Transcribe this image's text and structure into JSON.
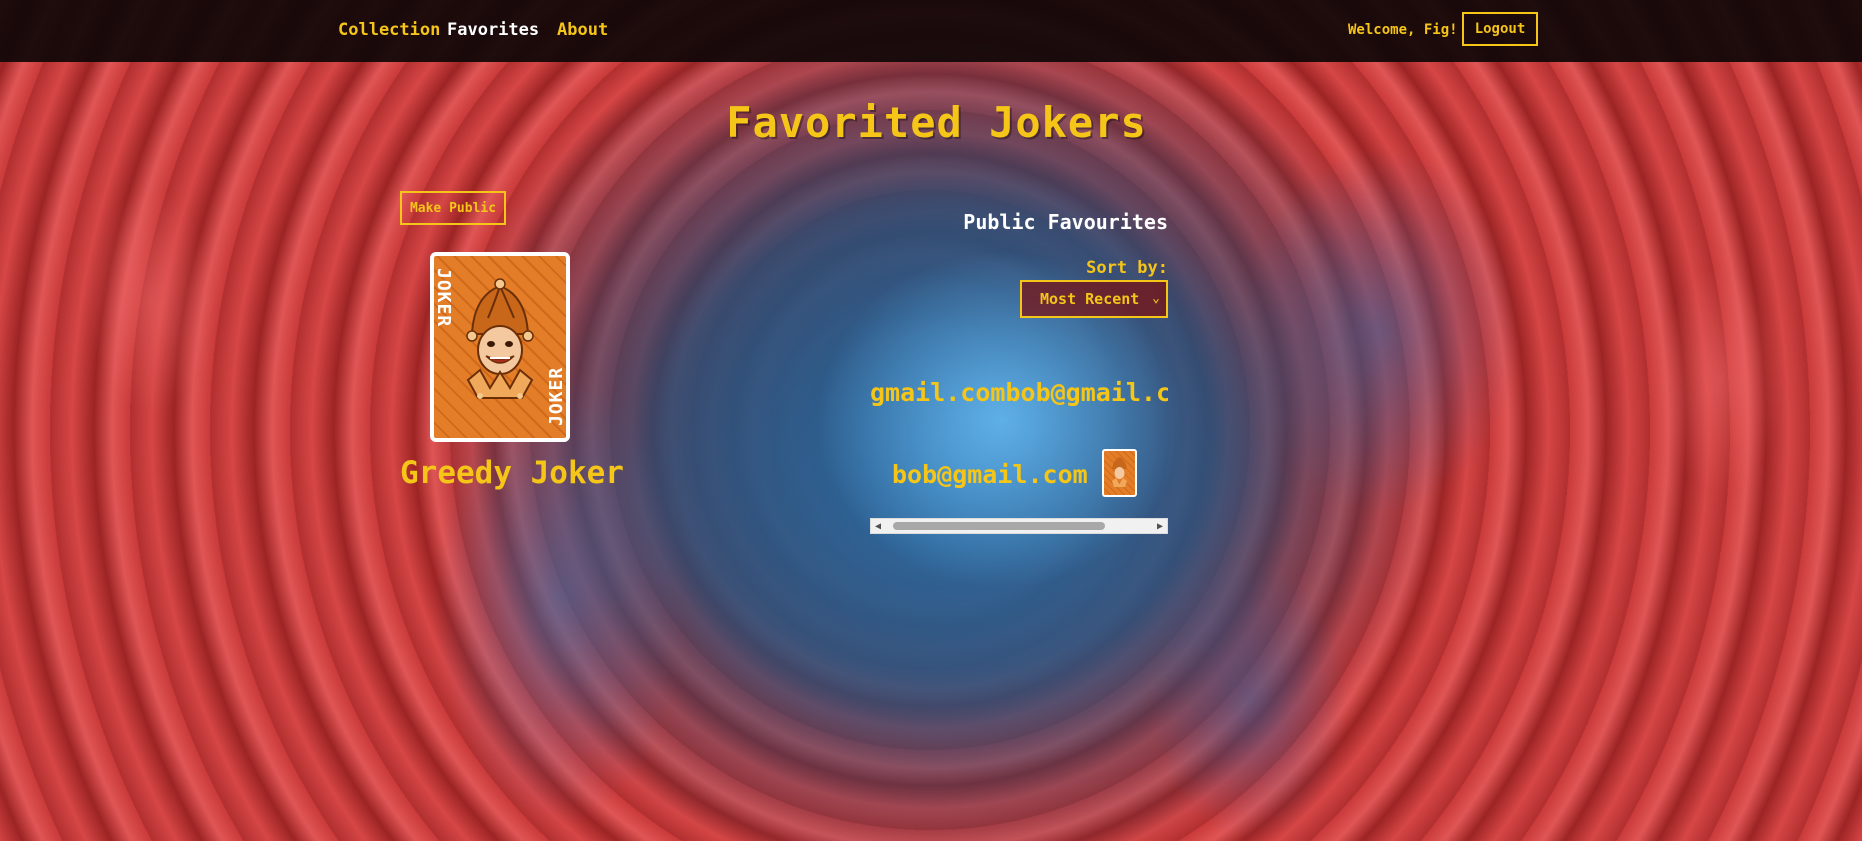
{
  "nav": {
    "links": [
      "Collection",
      "Favorites",
      "About"
    ],
    "active": "Favorites",
    "welcome": "Welcome, Fig!",
    "logout_label": "Logout"
  },
  "page": {
    "title": "Favorited Jokers"
  },
  "my_favorites": {
    "make_public_label": "Make Public",
    "cards": [
      {
        "name": "Greedy Joker",
        "card_text": "JOKER"
      }
    ]
  },
  "public_favorites": {
    "title": "Public Favourites",
    "sort_label": "Sort by:",
    "sort_selected": "Most Recent",
    "user_heading": "gmail.combob@gmail.com",
    "entries": [
      {
        "user": "bob@gmail.com",
        "card_icon": "joker-card-thumbnail"
      }
    ]
  },
  "colors": {
    "accent": "#f5c518",
    "navbar_bg": "#0e0608",
    "card_orange": "#e37d28",
    "text_white": "#ffffff"
  }
}
